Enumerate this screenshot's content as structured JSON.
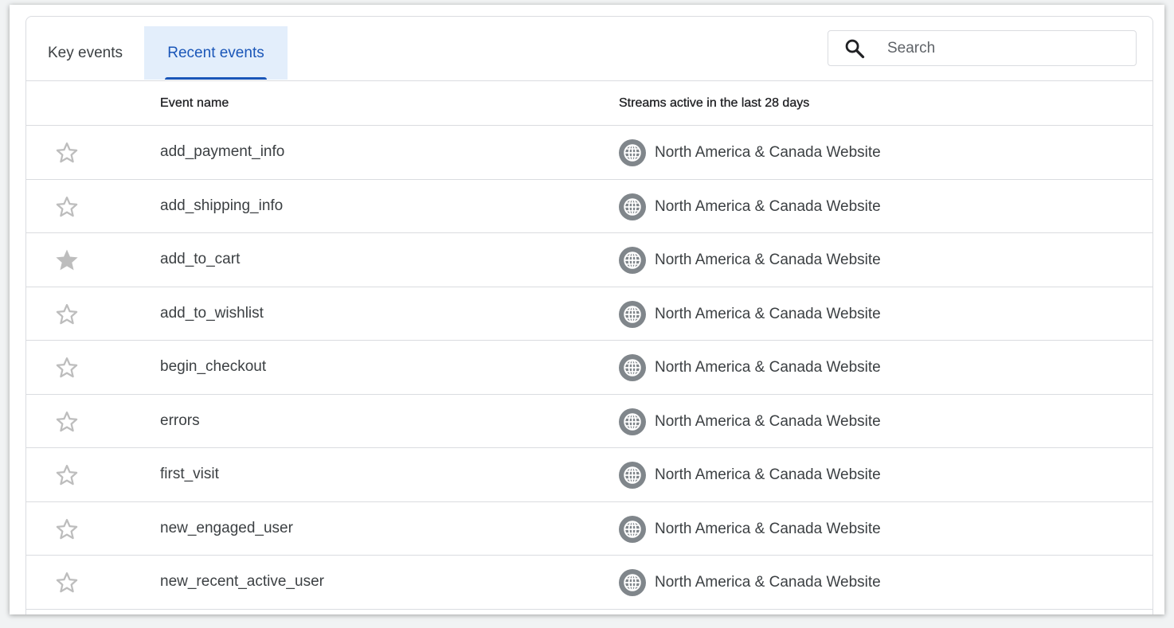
{
  "tabs": {
    "key_events": "Key events",
    "recent_events": "Recent events"
  },
  "search": {
    "placeholder": "Search",
    "value": ""
  },
  "table": {
    "columns": {
      "event_name": "Event name",
      "streams": "Streams active in the last 28 days"
    },
    "rows": [
      {
        "name": "add_payment_info",
        "stream": "North America & Canada Website",
        "starred": false
      },
      {
        "name": "add_shipping_info",
        "stream": "North America & Canada Website",
        "starred": false
      },
      {
        "name": "add_to_cart",
        "stream": "North America & Canada Website",
        "starred": true
      },
      {
        "name": "add_to_wishlist",
        "stream": "North America & Canada Website",
        "starred": false
      },
      {
        "name": "begin_checkout",
        "stream": "North America & Canada Website",
        "starred": false
      },
      {
        "name": "errors",
        "stream": "North America & Canada Website",
        "starred": false
      },
      {
        "name": "first_visit",
        "stream": "North America & Canada Website",
        "starred": false
      },
      {
        "name": "new_engaged_user",
        "stream": "North America & Canada Website",
        "starred": false
      },
      {
        "name": "new_recent_active_user",
        "stream": "North America & Canada Website",
        "starred": false
      }
    ]
  },
  "icons": {
    "star": "star-icon",
    "globe": "globe-icon",
    "search": "search-icon"
  },
  "colors": {
    "accent": "#1a56b8",
    "active_tab_bg": "#e3eefb",
    "star_outline": "#bdbdbd",
    "star_filled": "#bdbdbd",
    "globe_bg": "#80868b"
  }
}
